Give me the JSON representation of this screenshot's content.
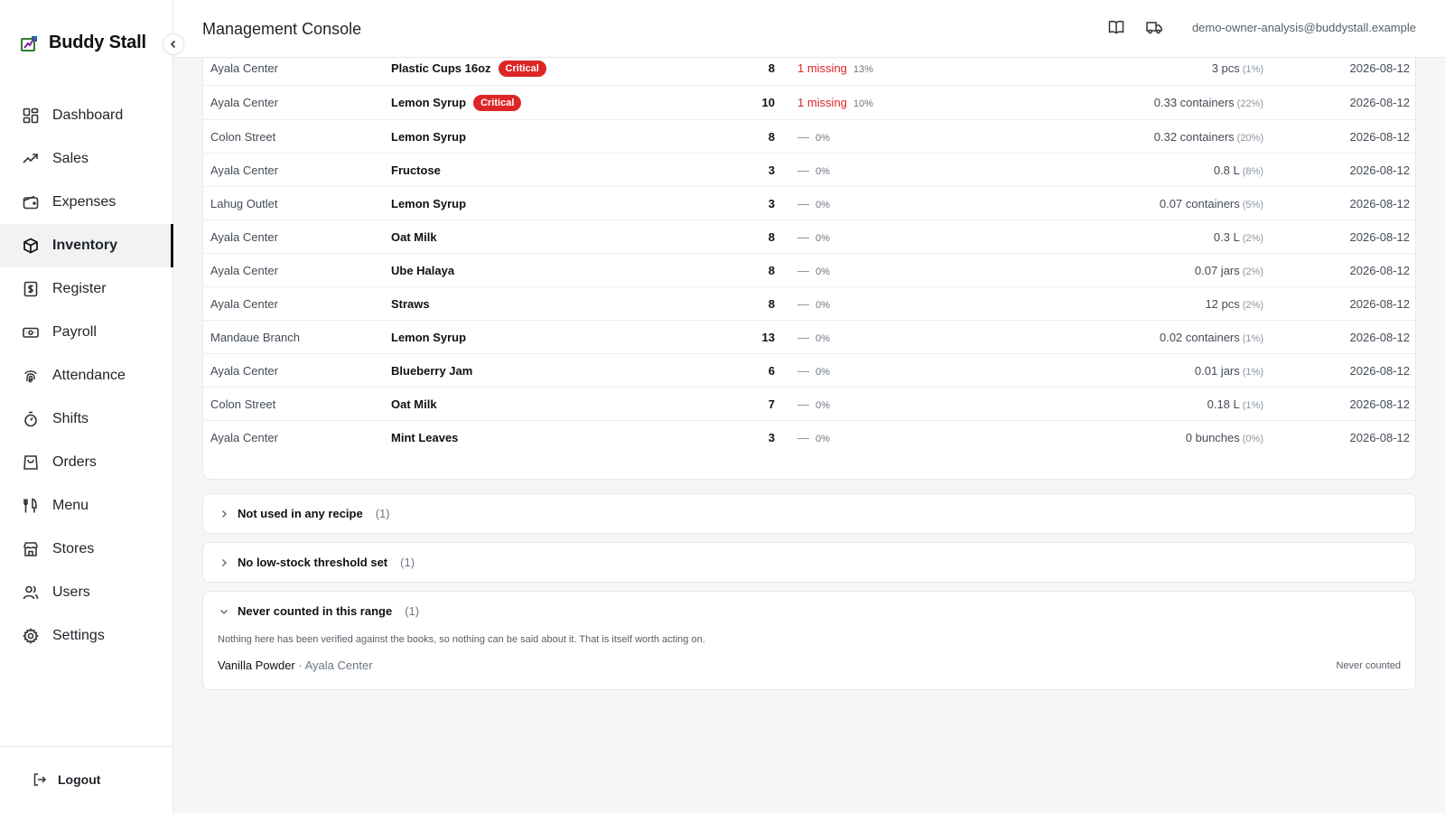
{
  "brand": {
    "name": "Buddy Stall"
  },
  "sidebar": {
    "items": [
      {
        "label": "Dashboard",
        "icon": "dashboard-icon"
      },
      {
        "label": "Sales",
        "icon": "trending-up-icon"
      },
      {
        "label": "Expenses",
        "icon": "wallet-icon"
      },
      {
        "label": "Inventory",
        "icon": "box-icon",
        "active": true
      },
      {
        "label": "Register",
        "icon": "receipt-icon"
      },
      {
        "label": "Payroll",
        "icon": "banknote-icon"
      },
      {
        "label": "Attendance",
        "icon": "fingerprint-icon"
      },
      {
        "label": "Shifts",
        "icon": "timer-icon"
      },
      {
        "label": "Orders",
        "icon": "shopping-bag-icon"
      },
      {
        "label": "Menu",
        "icon": "utensils-icon"
      },
      {
        "label": "Stores",
        "icon": "store-icon"
      },
      {
        "label": "Users",
        "icon": "users-icon"
      },
      {
        "label": "Settings",
        "icon": "gear-icon"
      }
    ],
    "logout_label": "Logout"
  },
  "header": {
    "title": "Management Console",
    "user_email": "demo-owner-analysis@buddystall.example"
  },
  "table": {
    "rows": [
      {
        "store": "Ayala Center",
        "item": "Plastic Cups 16oz",
        "badge": "Critical",
        "count": "8",
        "diff": "1 missing",
        "diff_pct": "13%",
        "qty": "3 pcs",
        "qty_pct": "(1%)",
        "date": "2026-08-12"
      },
      {
        "store": "Ayala Center",
        "item": "Lemon Syrup",
        "badge": "Critical",
        "count": "10",
        "diff": "1 missing",
        "diff_pct": "10%",
        "qty": "0.33 containers",
        "qty_pct": "(22%)",
        "date": "2026-08-12"
      },
      {
        "store": "Colon Street",
        "item": "Lemon Syrup",
        "badge": "",
        "count": "8",
        "diff": "—",
        "diff_pct": "0%",
        "qty": "0.32 containers",
        "qty_pct": "(20%)",
        "date": "2026-08-12"
      },
      {
        "store": "Ayala Center",
        "item": "Fructose",
        "badge": "",
        "count": "3",
        "diff": "—",
        "diff_pct": "0%",
        "qty": "0.8 L",
        "qty_pct": "(8%)",
        "date": "2026-08-12"
      },
      {
        "store": "Lahug Outlet",
        "item": "Lemon Syrup",
        "badge": "",
        "count": "3",
        "diff": "—",
        "diff_pct": "0%",
        "qty": "0.07 containers",
        "qty_pct": "(5%)",
        "date": "2026-08-12"
      },
      {
        "store": "Ayala Center",
        "item": "Oat Milk",
        "badge": "",
        "count": "8",
        "diff": "—",
        "diff_pct": "0%",
        "qty": "0.3 L",
        "qty_pct": "(2%)",
        "date": "2026-08-12"
      },
      {
        "store": "Ayala Center",
        "item": "Ube Halaya",
        "badge": "",
        "count": "8",
        "diff": "—",
        "diff_pct": "0%",
        "qty": "0.07 jars",
        "qty_pct": "(2%)",
        "date": "2026-08-12"
      },
      {
        "store": "Ayala Center",
        "item": "Straws",
        "badge": "",
        "count": "8",
        "diff": "—",
        "diff_pct": "0%",
        "qty": "12 pcs",
        "qty_pct": "(2%)",
        "date": "2026-08-12"
      },
      {
        "store": "Mandaue Branch",
        "item": "Lemon Syrup",
        "badge": "",
        "count": "13",
        "diff": "—",
        "diff_pct": "0%",
        "qty": "0.02 containers",
        "qty_pct": "(1%)",
        "date": "2026-08-12"
      },
      {
        "store": "Ayala Center",
        "item": "Blueberry Jam",
        "badge": "",
        "count": "6",
        "diff": "—",
        "diff_pct": "0%",
        "qty": "0.01 jars",
        "qty_pct": "(1%)",
        "date": "2026-08-12"
      },
      {
        "store": "Colon Street",
        "item": "Oat Milk",
        "badge": "",
        "count": "7",
        "diff": "—",
        "diff_pct": "0%",
        "qty": "0.18 L",
        "qty_pct": "(1%)",
        "date": "2026-08-12"
      },
      {
        "store": "Ayala Center",
        "item": "Mint Leaves",
        "badge": "",
        "count": "3",
        "diff": "—",
        "diff_pct": "0%",
        "qty": "0 bunches",
        "qty_pct": "(0%)",
        "date": "2026-08-12"
      }
    ]
  },
  "sections": {
    "not_used": {
      "title": "Not used in any recipe",
      "count": "(1)"
    },
    "no_threshold": {
      "title": "No low-stock threshold set",
      "count": "(1)"
    },
    "never_counted": {
      "title": "Never counted in this range",
      "count": "(1)",
      "description": "Nothing here has been verified against the books, so nothing can be said about it. That is itself worth acting on.",
      "item_name": "Vanilla Powder",
      "item_location": "· Ayala Center",
      "status": "Never counted"
    }
  },
  "colors": {
    "accent": "#111111",
    "critical": "#dc2626",
    "missing": "#dc2626"
  }
}
